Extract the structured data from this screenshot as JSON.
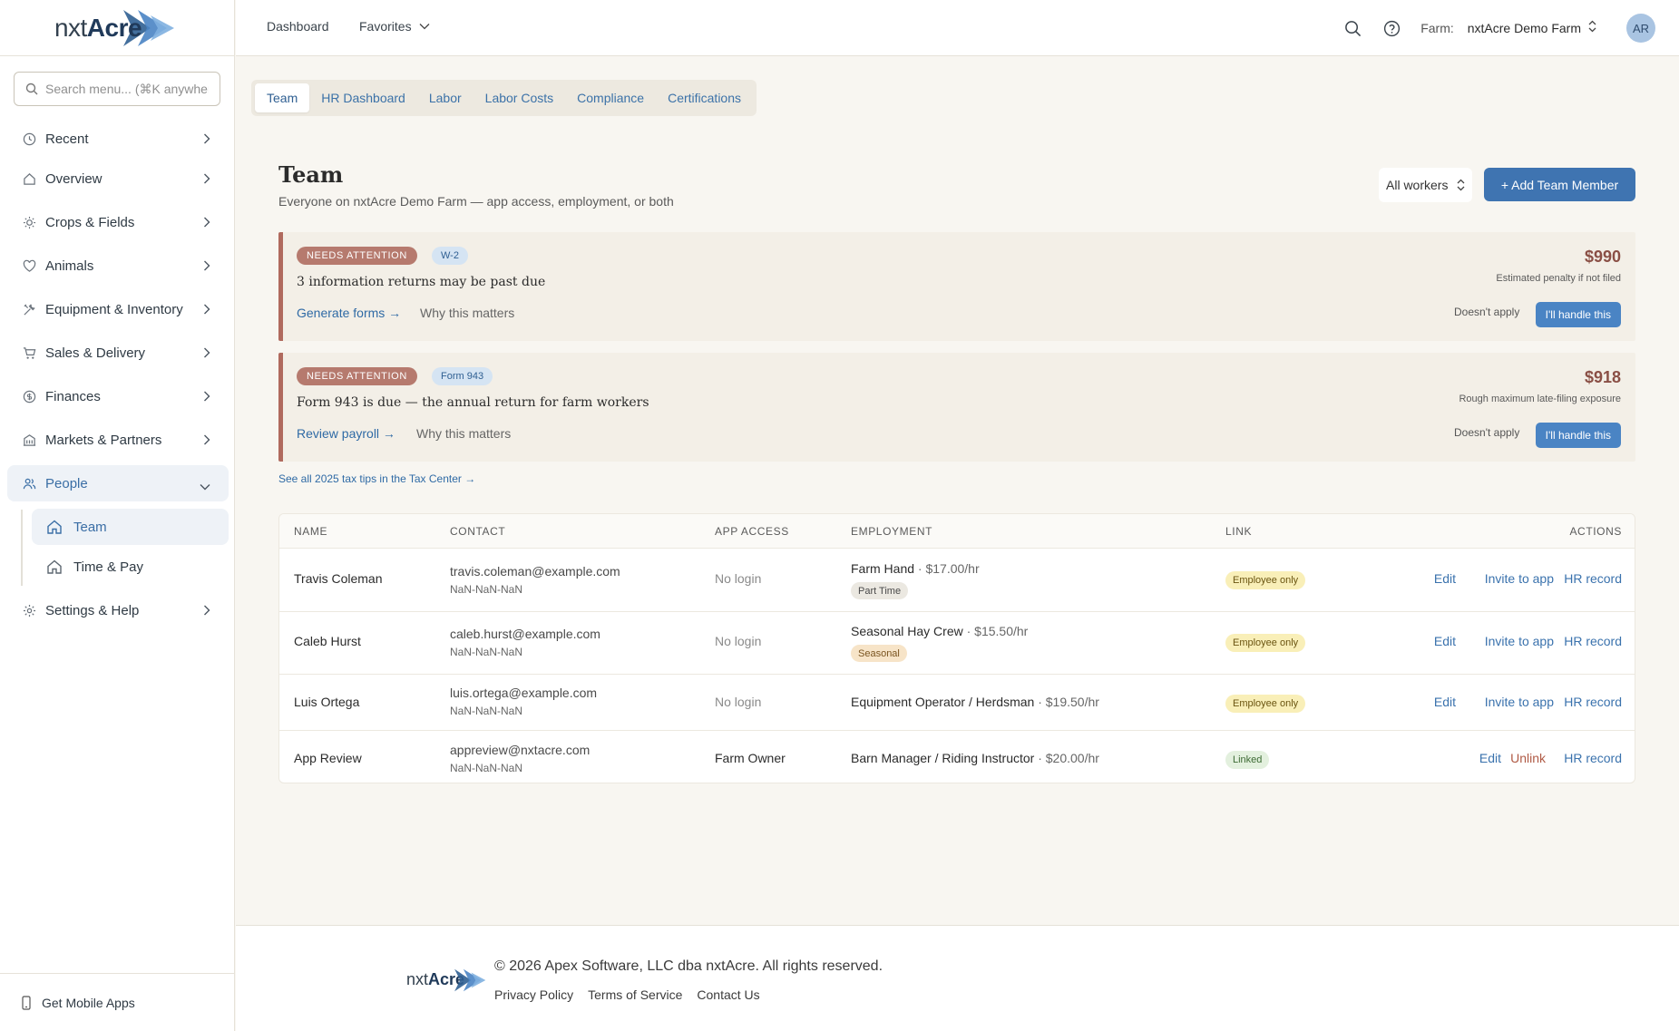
{
  "app": {
    "logo_prefix": "nxt",
    "logo_suffix": "Acre",
    "colors": {
      "primary": "#3f74b1",
      "alert": "#b06a5e",
      "background": "#f8f6f1"
    }
  },
  "sidebar": {
    "search_placeholder": "Search menu... (⌘K anywhere)",
    "items": [
      {
        "label": "Recent",
        "icon": "clock-icon"
      },
      {
        "label": "Overview",
        "icon": "home-icon"
      },
      {
        "label": "Crops & Fields",
        "icon": "sun-icon"
      },
      {
        "label": "Animals",
        "icon": "heart-icon"
      },
      {
        "label": "Equipment & Inventory",
        "icon": "tools-icon"
      },
      {
        "label": "Sales & Delivery",
        "icon": "cart-icon"
      },
      {
        "label": "Finances",
        "icon": "dollar-icon"
      },
      {
        "label": "Markets & Partners",
        "icon": "building-icon"
      },
      {
        "label": "People",
        "icon": "users-icon"
      },
      {
        "label": "Settings & Help",
        "icon": "gear-icon"
      }
    ],
    "people_sub": [
      {
        "label": "Team",
        "icon": "home-icon"
      },
      {
        "label": "Time & Pay",
        "icon": "home-icon"
      }
    ],
    "mobile_label": "Get Mobile Apps"
  },
  "header": {
    "dashboard": "Dashboard",
    "favorites": "Favorites",
    "farm_label": "Farm:",
    "farm_name": "nxtAcre Demo Farm",
    "avatar": "AR"
  },
  "tabs": [
    "Team",
    "HR Dashboard",
    "Labor",
    "Labor Costs",
    "Compliance",
    "Certifications"
  ],
  "page": {
    "title": "Team",
    "subtitle": "Everyone on nxtAcre Demo Farm — app access, employment, or both",
    "filter_value": "All workers",
    "add_button": "+ Add Team Member"
  },
  "alerts": [
    {
      "badge": "NEEDS ATTENTION",
      "type": "W-2",
      "title": "3 information returns may be past due",
      "link": "Generate forms →",
      "why": "Why this matters",
      "amount": "$990",
      "amount_sub": "Estimated penalty if not filed",
      "dismiss": "Doesn't apply",
      "handle": "I'll handle this"
    },
    {
      "badge": "NEEDS ATTENTION",
      "type": "Form 943",
      "title": "Form 943 is due — the annual return for farm workers",
      "link": "Review payroll →",
      "why": "Why this matters",
      "amount": "$918",
      "amount_sub": "Rough maximum late-filing exposure",
      "dismiss": "Doesn't apply",
      "handle": "I'll handle this"
    }
  ],
  "tax_link": "See all 2025 tax tips in the Tax Center →",
  "table": {
    "headers": [
      "NAME",
      "CONTACT",
      "APP ACCESS",
      "EMPLOYMENT",
      "LINK",
      "ACTIONS"
    ],
    "rows": [
      {
        "name": "Travis Coleman",
        "email": "travis.coleman@example.com",
        "phone": "NaN-NaN-NaN",
        "access": "No login",
        "role": "Farm Hand",
        "rate": "· $17.00/hr",
        "emp_badge": "Part Time",
        "link": "Employee only",
        "actions": [
          "Edit",
          "Invite to app",
          "HR record"
        ]
      },
      {
        "name": "Caleb Hurst",
        "email": "caleb.hurst@example.com",
        "phone": "NaN-NaN-NaN",
        "access": "No login",
        "role": "Seasonal Hay Crew",
        "rate": "· $15.50/hr",
        "emp_badge": "Seasonal",
        "link": "Employee only",
        "actions": [
          "Edit",
          "Invite to app",
          "HR record"
        ]
      },
      {
        "name": "Luis Ortega",
        "email": "luis.ortega@example.com",
        "phone": "NaN-NaN-NaN",
        "access": "No login",
        "role": "Equipment Operator / Herdsman",
        "rate": "· $19.50/hr",
        "emp_badge": "",
        "link": "Employee only",
        "actions": [
          "Edit",
          "Invite to app",
          "HR record"
        ]
      },
      {
        "name": "App Review",
        "email": "appreview@nxtacre.com",
        "phone": "NaN-NaN-NaN",
        "access": "Farm Owner",
        "role": "Barn Manager / Riding Instructor",
        "rate": "· $20.00/hr",
        "emp_badge": "",
        "link": "Linked",
        "actions": [
          "Edit",
          "Unlink",
          "HR record"
        ]
      }
    ]
  },
  "footer": {
    "copyright": "© 2026 Apex Software, LLC dba nxtAcre. All rights reserved.",
    "links": [
      "Privacy Policy",
      "Terms of Service",
      "Contact Us"
    ]
  }
}
